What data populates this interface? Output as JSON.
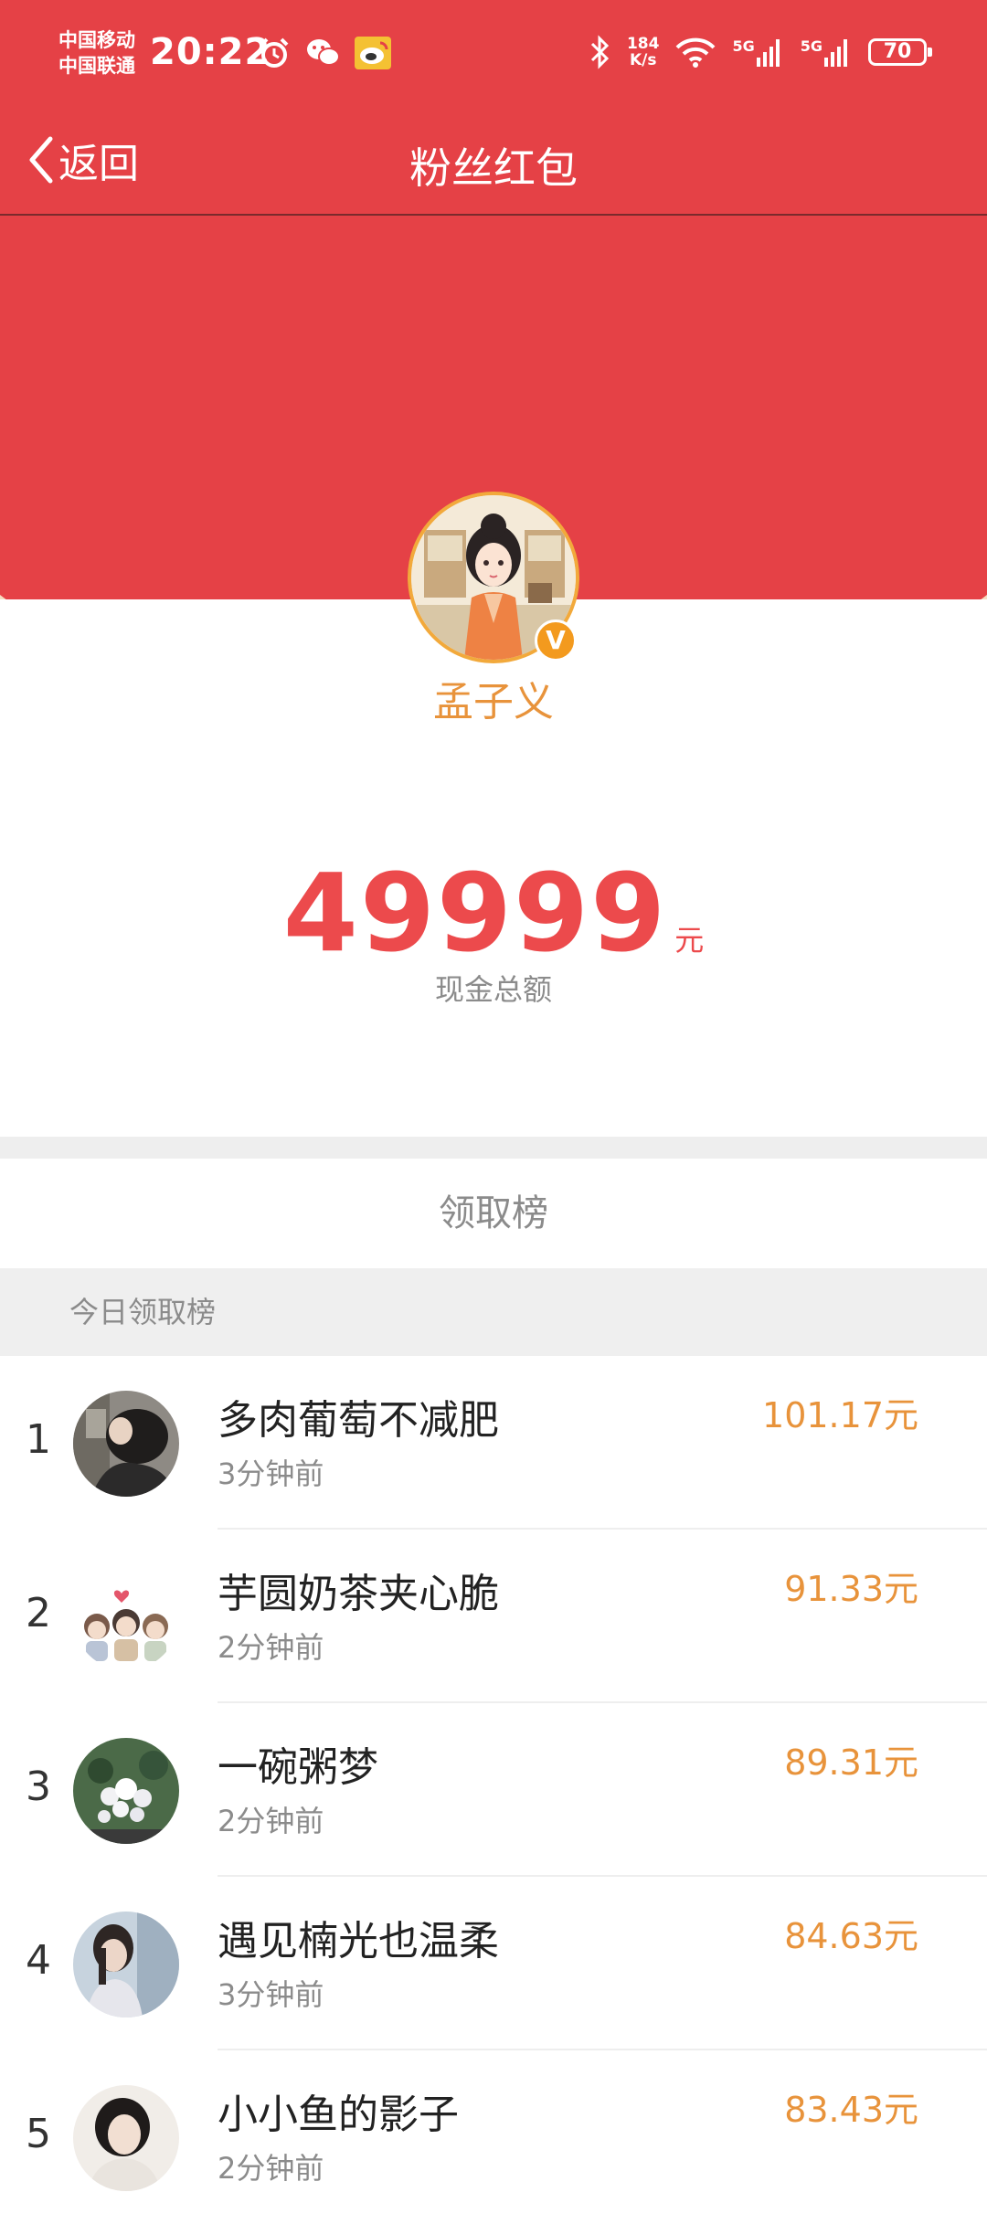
{
  "status_bar": {
    "carrier1": "中国移动",
    "carrier2": "中国联通",
    "time": "20:22",
    "net_speed_value": "184",
    "net_speed_unit": "K/s",
    "signal1": "5G",
    "signal2": "5G",
    "battery": "70"
  },
  "nav": {
    "back_label": "返回",
    "title": "粉丝红包"
  },
  "host": {
    "name": "孟子义"
  },
  "envelope": {
    "amount": "49999",
    "unit": "元",
    "caption": "现金总额"
  },
  "board": {
    "title": "领取榜",
    "section": "今日领取榜",
    "rows": [
      {
        "rank": "1",
        "name": "多肉葡萄不减肥",
        "time": "3分钟前",
        "amount": "101.17元"
      },
      {
        "rank": "2",
        "name": "芋圆奶茶夹心脆",
        "time": "2分钟前",
        "amount": "91.33元"
      },
      {
        "rank": "3",
        "name": "一碗粥梦",
        "time": "2分钟前",
        "amount": "89.31元"
      },
      {
        "rank": "4",
        "name": "遇见楠光也温柔",
        "time": "3分钟前",
        "amount": "84.63元"
      },
      {
        "rank": "5",
        "name": "小小鱼的影子",
        "time": "2分钟前",
        "amount": "83.43元"
      }
    ]
  },
  "colors": {
    "brand_red": "#e54146",
    "amount_red": "#ec4a4c",
    "gold": "#e8933b",
    "envelope_rim": "#f6dcc0",
    "muted_text": "#8b8b8b"
  }
}
